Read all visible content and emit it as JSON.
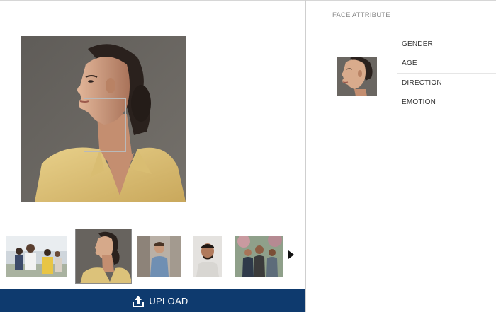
{
  "face_attribute": {
    "header": "FACE ATTRIBUTE",
    "attributes": [
      {
        "label": "GENDER"
      },
      {
        "label": "AGE"
      },
      {
        "label": "DIRECTION"
      },
      {
        "label": "EMOTION"
      }
    ]
  },
  "upload": {
    "label": "UPLOAD",
    "icon": "upload-icon"
  },
  "gallery": {
    "selected_index": 1,
    "thumbnails": [
      {
        "name": "thumb-group-outdoor"
      },
      {
        "name": "thumb-woman-profile"
      },
      {
        "name": "thumb-man-street"
      },
      {
        "name": "thumb-man-portrait"
      },
      {
        "name": "thumb-group-friends"
      }
    ],
    "next_icon": "chevron-right-icon"
  },
  "colors": {
    "upload_bar": "#0e3a6e",
    "divider": "#cfcfcf",
    "face_box": "#b9b9b9"
  }
}
